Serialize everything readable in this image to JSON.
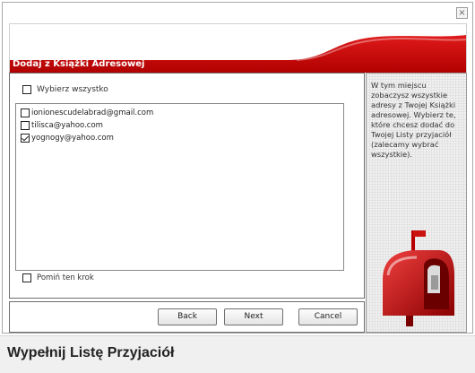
{
  "window": {
    "close_glyph": "×"
  },
  "header": {
    "title": "Dodaj z Książki Adresowej",
    "accent_color": "#cc0000"
  },
  "main": {
    "select_all_label": "Wybierz wszystko",
    "contacts": [
      {
        "email": "ionionescudelabrad@gmail.com",
        "checked": false
      },
      {
        "email": "tilisca@yahoo.com",
        "checked": false
      },
      {
        "email": "yognogy@yahoo.com",
        "checked": true
      }
    ],
    "skip_label": "Pomiń ten krok"
  },
  "buttons": {
    "back": "Back",
    "next": "Next",
    "cancel": "Cancel"
  },
  "side": {
    "text": "W tym miejscu zobaczysz wszystkie adresy z Twojej Książki adresowej. Wybierz te, które chcesz dodać do Twojej Listy przyjaciół (zalecamy wybrać wszystkie).",
    "icon": "mailbox-icon"
  },
  "footer": {
    "title": "Wypełnij Listę Przyjaciół"
  }
}
